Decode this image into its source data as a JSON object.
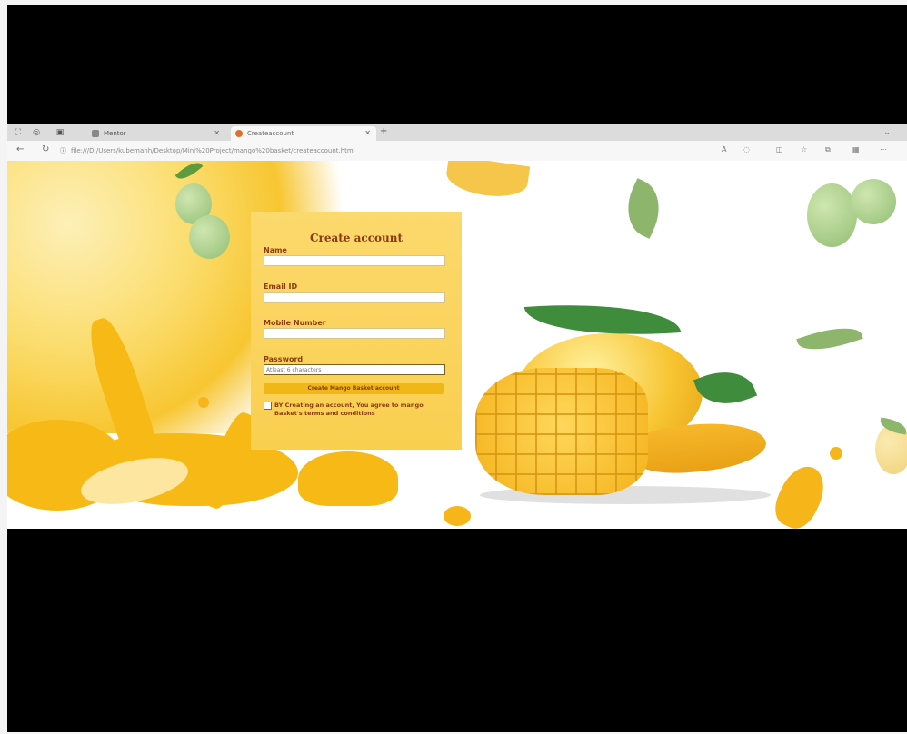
{
  "browser": {
    "tabs": [
      {
        "title": "Mentor",
        "active": false
      },
      {
        "title": "Createaccount",
        "active": true
      }
    ],
    "new_tab": "+",
    "url": "file:///D:/Users/kubemanh/Desktop/Mini%20Project/mango%20basket/createaccount.html"
  },
  "form": {
    "title": "Create account",
    "name_label": "Name",
    "email_label": "Email ID",
    "mobile_label": "Mobile Number",
    "password_label": "Password",
    "password_placeholder": "Atleast 6 characters",
    "submit_label": "Create Mango Basket account",
    "terms_text": "BY Creating an account, You agree to mango Basket's terms and conditions"
  },
  "colors": {
    "accent": "#f9cf4f",
    "text": "#8b3a12",
    "button": "#f0b817"
  }
}
